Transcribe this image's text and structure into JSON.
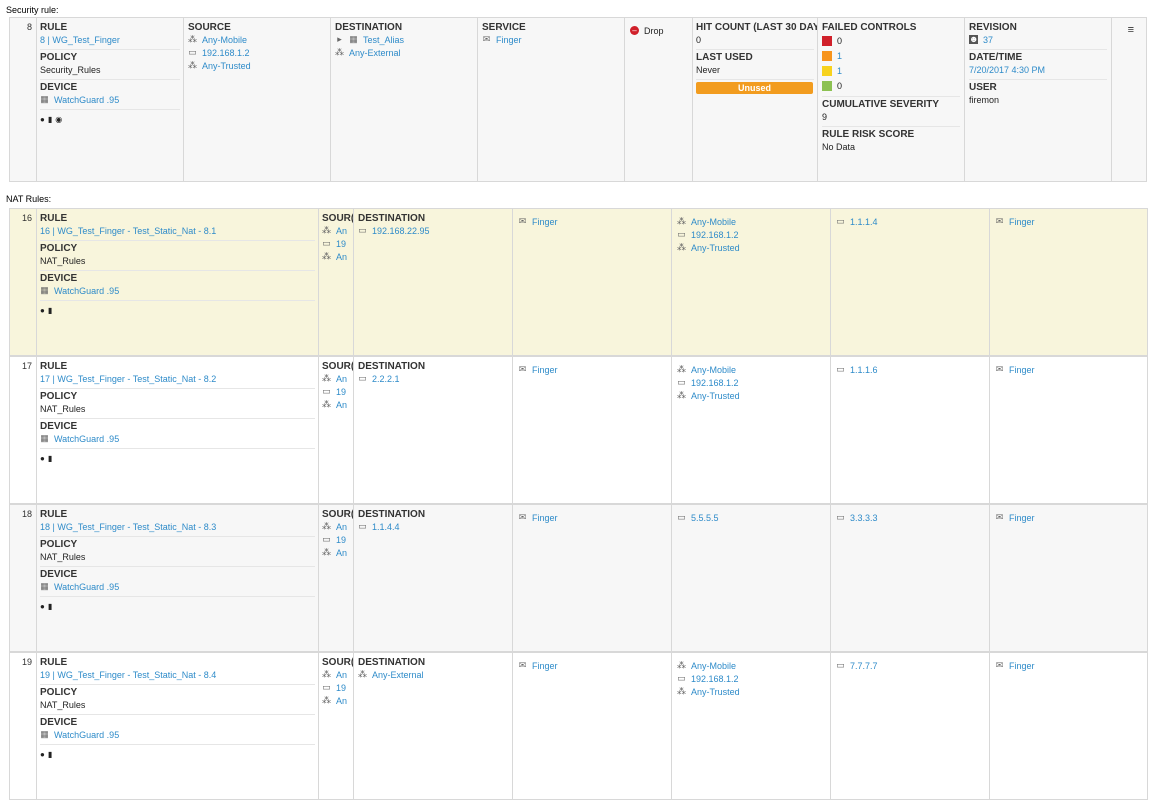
{
  "security": {
    "section_title": "Security rule:",
    "row_num": "8",
    "rule_header": "RULE",
    "rule_link": "8 | WG_Test_Finger",
    "policy_header": "POLICY",
    "policy_value": "Security_Rules",
    "device_header": "DEVICE",
    "device_link": "WatchGuard .95",
    "source_header": "SOURCE",
    "source_items": [
      "Any-Mobile",
      "192.168.1.2",
      "Any-Trusted"
    ],
    "dest_header": "DESTINATION",
    "dest_items": [
      "Test_Alias",
      "Any-External"
    ],
    "service_header": "SERVICE",
    "service_items": [
      "Finger"
    ],
    "action": "Drop",
    "hit_header": "HIT COUNT (LAST 30 DAYS",
    "hit_value": "0",
    "last_used_header": "LAST USED",
    "last_used_value": "Never",
    "unused_badge": "Unused",
    "failed_header": "FAILED CONTROLS",
    "failed_values": [
      "0",
      "1",
      "1",
      "0"
    ],
    "failed_colors": [
      "#d0202a",
      "#f7941d",
      "#f7d21d",
      "#8cc152"
    ],
    "cum_header": "CUMULATIVE SEVERITY",
    "cum_value": "9",
    "risk_header": "RULE RISK SCORE",
    "risk_value": "No Data",
    "rev_header": "REVISION",
    "rev_value": "37",
    "date_header": "DATE/TIME",
    "date_value": "7/20/2017 4:30 PM",
    "user_header": "USER",
    "user_value": "firemon"
  },
  "nat": {
    "section_title": "NAT Rules:",
    "rows": [
      {
        "num": "16",
        "rule_header": "RULE",
        "rule_link": "16 | WG_Test_Finger - Test_Static_Nat - 8.1",
        "policy_header": "POLICY",
        "policy_value": "NAT_Rules",
        "device_header": "DEVICE",
        "device_link": "WatchGuard .95",
        "source_header": "SOUR(",
        "source_items": [
          "An",
          "19",
          "An"
        ],
        "dest_header": "DESTINATION",
        "dest_items": [
          "192.168.22.95"
        ],
        "service": "Finger",
        "trans_source": [
          "Any-Mobile",
          "192.168.1.2",
          "Any-Trusted"
        ],
        "trans_dest": "1.1.1.4",
        "trans_service": "Finger"
      },
      {
        "num": "17",
        "rule_header": "RULE",
        "rule_link": "17 | WG_Test_Finger - Test_Static_Nat - 8.2",
        "policy_header": "POLICY",
        "policy_value": "NAT_Rules",
        "device_header": "DEVICE",
        "device_link": "WatchGuard .95",
        "source_header": "SOUR(",
        "source_items": [
          "An",
          "19",
          "An"
        ],
        "dest_header": "DESTINATION",
        "dest_items": [
          "2.2.2.1"
        ],
        "service": "Finger",
        "trans_source": [
          "Any-Mobile",
          "192.168.1.2",
          "Any-Trusted"
        ],
        "trans_dest": "1.1.1.6",
        "trans_service": "Finger"
      },
      {
        "num": "18",
        "rule_header": "RULE",
        "rule_link": "18 | WG_Test_Finger - Test_Static_Nat - 8.3",
        "policy_header": "POLICY",
        "policy_value": "NAT_Rules",
        "device_header": "DEVICE",
        "device_link": "WatchGuard .95",
        "source_header": "SOUR(",
        "source_items": [
          "An",
          "19",
          "An"
        ],
        "dest_header": "DESTINATION",
        "dest_items": [
          "1.1.4.4"
        ],
        "service": "Finger",
        "trans_source": [
          "5.5.5.5"
        ],
        "trans_dest": "3.3.3.3",
        "trans_service": "Finger"
      },
      {
        "num": "19",
        "rule_header": "RULE",
        "rule_link": "19 | WG_Test_Finger - Test_Static_Nat - 8.4",
        "policy_header": "POLICY",
        "policy_value": "NAT_Rules",
        "device_header": "DEVICE",
        "device_link": "WatchGuard .95",
        "source_header": "SOUR(",
        "source_items": [
          "An",
          "19",
          "An"
        ],
        "dest_header": "DESTINATION",
        "dest_items": [
          "Any-External"
        ],
        "service": "Finger",
        "trans_source": [
          "Any-Mobile",
          "192.168.1.2",
          "Any-Trusted"
        ],
        "trans_dest": "7.7.7.7",
        "trans_service": "Finger"
      }
    ]
  }
}
